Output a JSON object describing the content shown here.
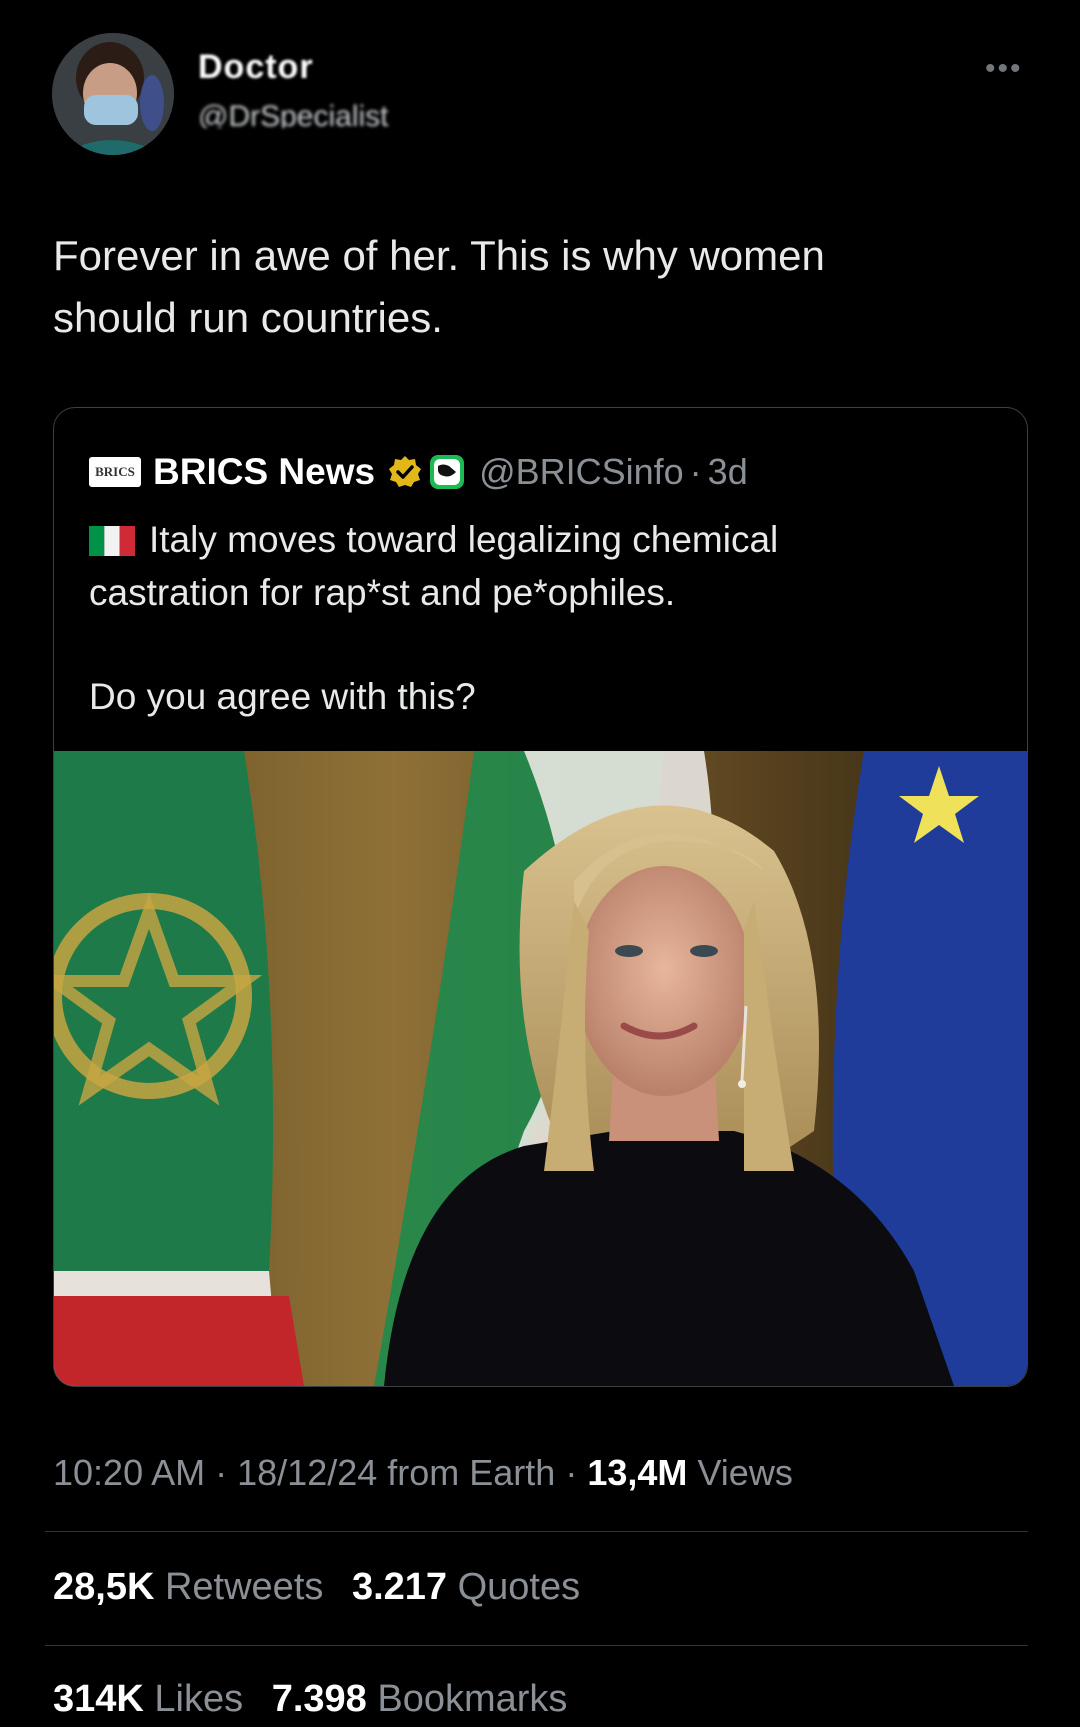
{
  "author": {
    "name": "Doctor",
    "handle": "@DrSpecialist"
  },
  "tweet": {
    "text_line1": "Forever in awe of her. This is why women",
    "text_line2": "should run countries."
  },
  "quoted": {
    "logo_text": "BRICS",
    "name": "BRICS News",
    "handle": "@BRICSinfo",
    "separator": "·",
    "time": "3d",
    "line1": "Italy moves toward legalizing chemical",
    "line2": "castration for rap*st and pe*ophiles.",
    "question": "Do you agree with this?",
    "icons": [
      "verified-badge-icon",
      "affiliate-badge-icon",
      "italy-flag-icon"
    ]
  },
  "meta": {
    "time": "10:20 AM",
    "sep1": "·",
    "date": "18/12/24 from Earth",
    "sep2": "·",
    "views_count": "13,4M",
    "views_label": "Views"
  },
  "stats": {
    "retweets_count": "28,5K",
    "retweets_label": "Retweets",
    "quotes_count": "3.217",
    "quotes_label": "Quotes",
    "likes_count": "314K",
    "likes_label": "Likes",
    "bookmarks_count": "7.398",
    "bookmarks_label": "Bookmarks"
  },
  "colors": {
    "background": "#000000",
    "text": "#e7e9ea",
    "muted": "#8b9096",
    "verified_gold": "#e2b719",
    "affiliate_green": "#1db954"
  }
}
